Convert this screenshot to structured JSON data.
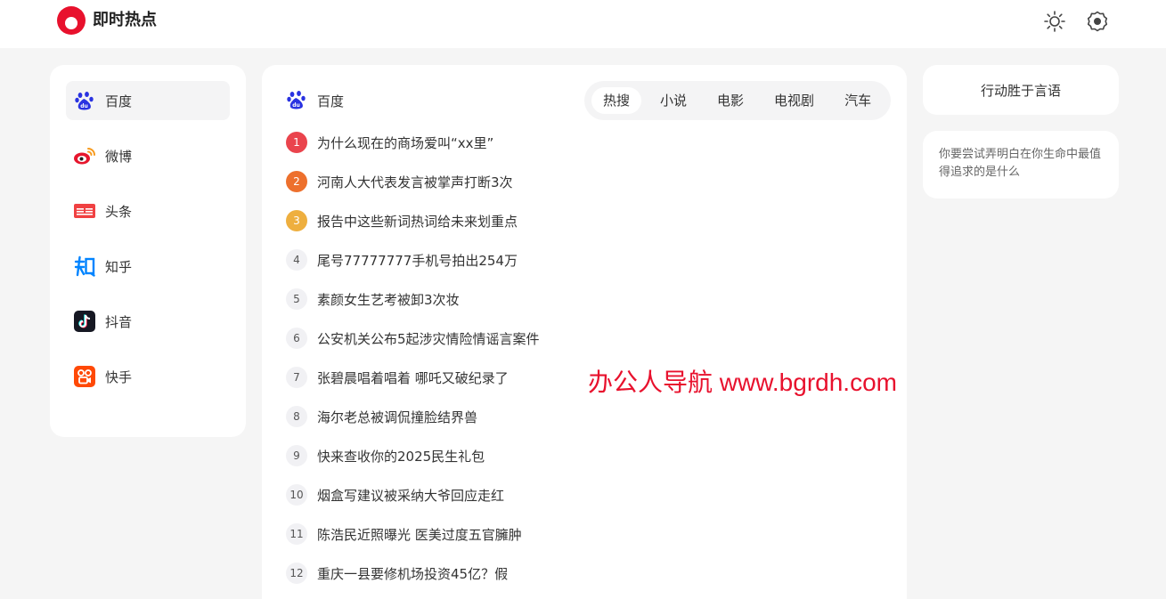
{
  "header": {
    "app_title": "即时热点",
    "logo_icon": "record-logo-icon",
    "theme_icon": "sun-icon",
    "settings_icon": "gear-icon",
    "accent": "#e8112d"
  },
  "sidebar": {
    "items": [
      {
        "label": "百度",
        "icon": "baidu-paw-icon",
        "active": true
      },
      {
        "label": "微博",
        "icon": "weibo-icon",
        "active": false
      },
      {
        "label": "头条",
        "icon": "toutiao-icon",
        "active": false
      },
      {
        "label": "知乎",
        "icon": "zhihu-icon",
        "active": false
      },
      {
        "label": "抖音",
        "icon": "douyin-icon",
        "active": false
      },
      {
        "label": "快手",
        "icon": "kuaishou-icon",
        "active": false
      }
    ]
  },
  "main": {
    "source_title": "百度",
    "source_icon": "baidu-paw-icon",
    "tabs": [
      {
        "label": "热搜",
        "active": true
      },
      {
        "label": "小说",
        "active": false
      },
      {
        "label": "电影",
        "active": false
      },
      {
        "label": "电视剧",
        "active": false
      },
      {
        "label": "汽车",
        "active": false
      }
    ],
    "items": [
      {
        "rank": "1",
        "title": "为什么现在的商场爱叫“xx里”"
      },
      {
        "rank": "2",
        "title": "河南人大代表发言被掌声打断3次"
      },
      {
        "rank": "3",
        "title": "报告中这些新词热词给未来划重点"
      },
      {
        "rank": "4",
        "title": "尾号77777777手机号拍出254万"
      },
      {
        "rank": "5",
        "title": "素颜女生艺考被卸3次妆"
      },
      {
        "rank": "6",
        "title": "公安机关公布5起涉灾情险情谣言案件"
      },
      {
        "rank": "7",
        "title": "张碧晨唱着唱着 哪吒又破纪录了"
      },
      {
        "rank": "8",
        "title": "海尔老总被调侃撞脸结界兽"
      },
      {
        "rank": "9",
        "title": "快来查收你的2025民生礼包"
      },
      {
        "rank": "10",
        "title": "烟盒写建议被采纳大爷回应走红"
      },
      {
        "rank": "11",
        "title": "陈浩民近照曝光 医美过度五官臃肿"
      },
      {
        "rank": "12",
        "title": "重庆一县要修机场投资45亿？假"
      }
    ]
  },
  "right": {
    "quote_title": "行动胜于言语",
    "quote_body": "你要尝试弄明白在你生命中最值得追求的是什么"
  },
  "watermark": "办公人导航 www.bgrdh.com"
}
